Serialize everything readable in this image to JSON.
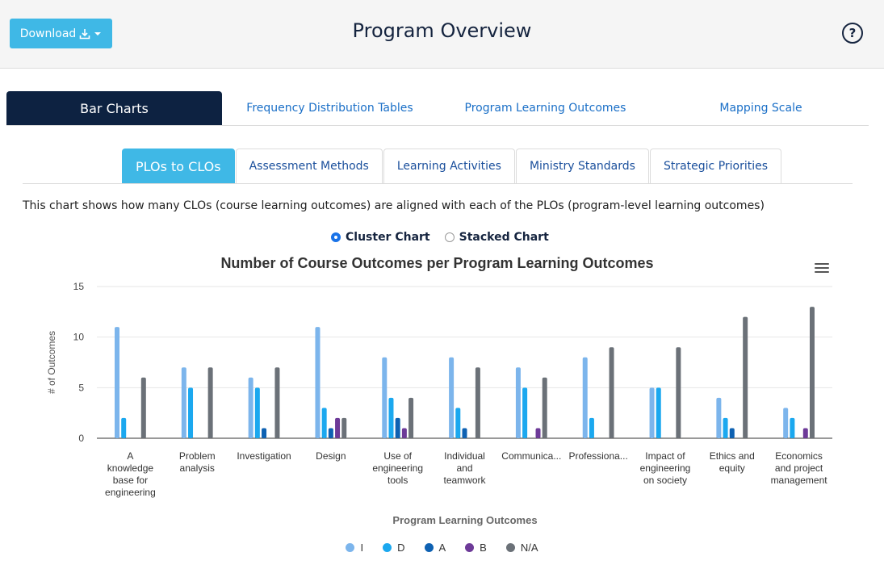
{
  "header": {
    "download_label": "Download",
    "title": "Program Overview",
    "help_label": "?"
  },
  "main_tabs": [
    {
      "label": "Bar Charts",
      "active": true
    },
    {
      "label": "Frequency Distribution Tables",
      "active": false
    },
    {
      "label": "Program Learning Outcomes",
      "active": false
    },
    {
      "label": "Mapping Scale",
      "active": false
    }
  ],
  "sub_tabs": [
    {
      "label": "PLOs to CLOs",
      "active": true
    },
    {
      "label": "Assessment Methods",
      "active": false
    },
    {
      "label": "Learning Activities",
      "active": false
    },
    {
      "label": "Ministry Standards",
      "active": false
    },
    {
      "label": "Strategic Priorities",
      "active": false
    }
  ],
  "description": "This chart shows how many CLOs (course learning outcomes) are aligned with each of the PLOs (program-level learning outcomes)",
  "chart_mode": {
    "options": [
      {
        "label": "Cluster Chart",
        "checked": true
      },
      {
        "label": "Stacked Chart",
        "checked": false
      }
    ]
  },
  "chart_data": {
    "type": "bar",
    "title": "Number of Course Outcomes per Program Learning Outcomes",
    "xlabel": "Program Learning Outcomes",
    "ylabel": "# of Outcomes",
    "ylim": [
      0,
      15
    ],
    "yticks": [
      0,
      5,
      10,
      15
    ],
    "grid": true,
    "legend_position": "bottom",
    "categories": [
      [
        "A",
        "knowledge",
        "base for",
        "engineering"
      ],
      [
        "Problem",
        "analysis"
      ],
      [
        "Investigation"
      ],
      [
        "Design"
      ],
      [
        "Use of",
        "engineering",
        "tools"
      ],
      [
        "Individual",
        "and",
        "teamwork"
      ],
      [
        "Communica..."
      ],
      [
        "Professiona..."
      ],
      [
        "Impact of",
        "engineering",
        "on society"
      ],
      [
        "Ethics and",
        "equity"
      ],
      [
        "Economics",
        "and project",
        "management"
      ]
    ],
    "series": [
      {
        "name": "I",
        "color": "#7cb5ec",
        "values": [
          11,
          7,
          6,
          11,
          8,
          8,
          7,
          8,
          5,
          4,
          3
        ]
      },
      {
        "name": "D",
        "color": "#1ba8ef",
        "values": [
          2,
          5,
          5,
          3,
          4,
          3,
          5,
          2,
          5,
          2,
          2
        ]
      },
      {
        "name": "A",
        "color": "#0e61b2",
        "values": [
          0,
          0,
          1,
          1,
          2,
          1,
          0,
          0,
          0,
          1,
          0
        ]
      },
      {
        "name": "B",
        "color": "#6d3a98",
        "values": [
          0,
          0,
          0,
          2,
          1,
          0,
          1,
          0,
          0,
          0,
          1
        ]
      },
      {
        "name": "N/A",
        "color": "#6b7178",
        "values": [
          6,
          7,
          7,
          2,
          4,
          7,
          6,
          9,
          9,
          12,
          13
        ]
      }
    ]
  }
}
